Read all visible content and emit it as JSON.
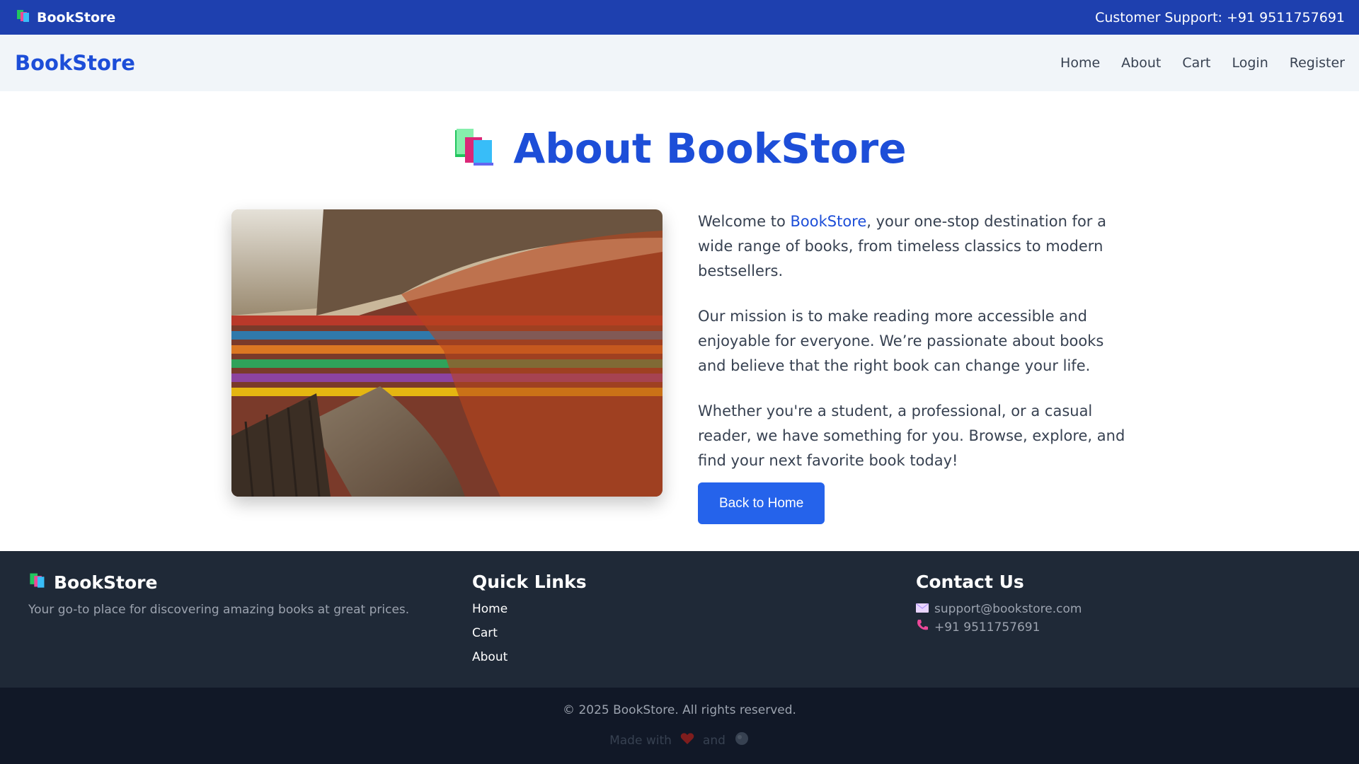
{
  "topbar": {
    "brand": "BookStore",
    "support": "Customer Support: +91 9511757691"
  },
  "nav": {
    "logo": "BookStore",
    "links": [
      "Home",
      "About",
      "Cart",
      "Login",
      "Register"
    ]
  },
  "main": {
    "title": "About BookStore",
    "image_alt": "Library bookshelves",
    "para1_prefix": "Welcome to ",
    "para1_brand": "BookStore",
    "para1_suffix": ", your one-stop destination for a wide range of books, from timeless classics to modern bestsellers.",
    "para2": "Our mission is to make reading more accessible and enjoyable for everyone. We’re passionate about books and believe that the right book can change your life.",
    "para3": "Whether you're a student, a professional, or a casual reader, we have something for you. Browse, explore, and find your next favorite book today!",
    "button": "Back to Home"
  },
  "footer": {
    "brand": "BookStore",
    "description": "Your go-to place for discovering amazing books at great prices.",
    "quick_links_title": "Quick Links",
    "quick_links": [
      "Home",
      "Cart",
      "About"
    ],
    "contact_title": "Contact Us",
    "email": "support@bookstore.com",
    "phone": "+91 9511757691"
  },
  "bottom": {
    "copyright": "© 2025 BookStore. All rights reserved.",
    "made_with": "Made with",
    "and": "and"
  },
  "colors": {
    "topbar_bg": "#1e40af",
    "accent": "#1d4ed8",
    "button_bg": "#2563eb",
    "footer_bg": "#1f2937",
    "bottom_bg": "#111827"
  }
}
